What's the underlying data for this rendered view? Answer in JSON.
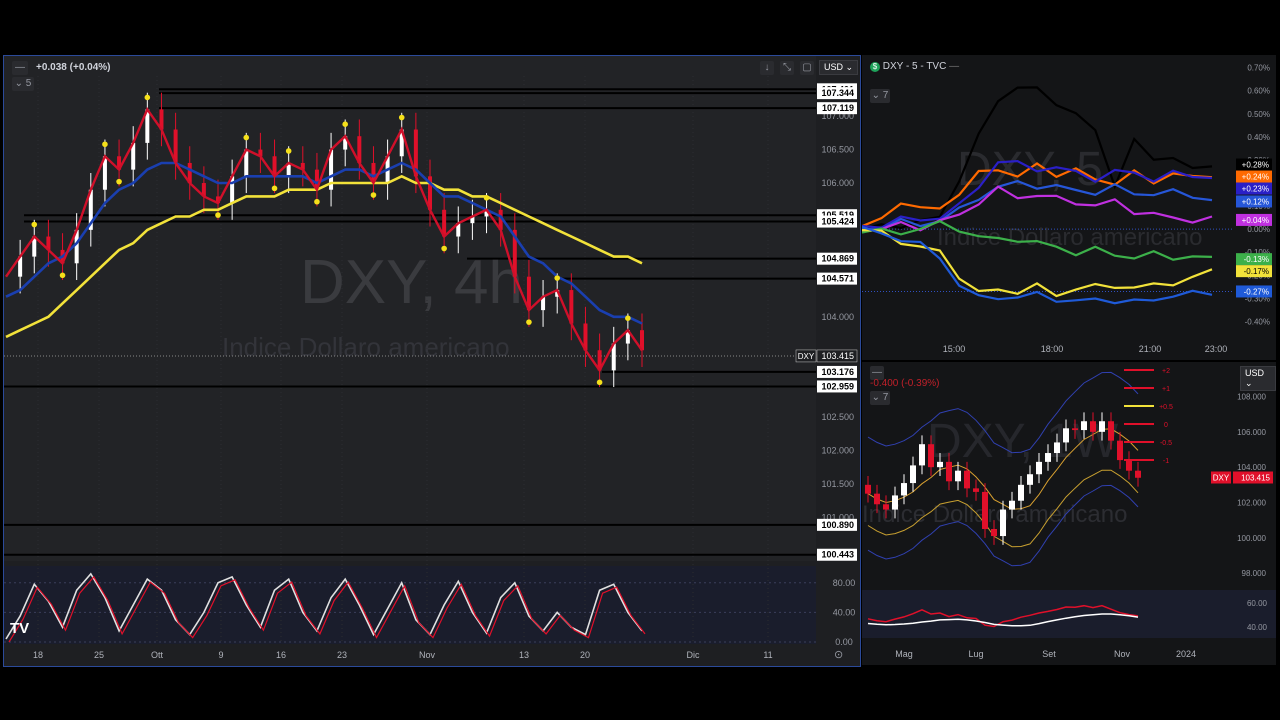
{
  "main": {
    "change_text": "+0.038 (+0.04%)",
    "collapse_glyph": "—",
    "indicator_count": "5",
    "currency": "USD",
    "watermark_title": "DXY, 4h",
    "watermark_subtitle": "Indice Dollaro americano",
    "symbol_tag": "DXY",
    "logo": "TV",
    "toolbar_icons": [
      "arrow-down-icon",
      "expand-icon",
      "maximize-icon"
    ],
    "settings_icon": "gear-icon",
    "colors": {
      "ema_fast": "#d0102a",
      "ema_mid": "#1a3fb0",
      "ema_slow": "#f2e23a",
      "pivot": "#f5e01a",
      "osc": "#e0e0e0",
      "osc_signal": "#e0102a"
    }
  },
  "chart_data": [
    {
      "type": "line",
      "title": "",
      "subtitle": "",
      "price_axis_ticks": [
        "107.000",
        "106.500",
        "106.000",
        "104.000",
        "102.500",
        "102.000",
        "101.500",
        "101.000"
      ],
      "price_labels": [
        "107.401",
        "107.344",
        "107.119",
        "105.519",
        "105.424",
        "104.869",
        "104.571",
        "103.415",
        "103.176",
        "102.959",
        "100.890",
        "100.443"
      ],
      "last_price": 103.415,
      "x_ticks": [
        "18",
        "25",
        "Ott",
        "9",
        "16",
        "23",
        "Nov",
        "13",
        "20",
        "Dic",
        "11"
      ],
      "ylim": [
        100.2,
        107.6
      ],
      "series": [
        {
          "values": [
            104.6,
            104.9,
            105.2,
            105.0,
            104.8,
            105.3,
            105.9,
            106.4,
            106.2,
            106.6,
            107.1,
            106.8,
            106.3,
            106.0,
            105.8,
            105.7,
            106.1,
            106.5,
            106.4,
            106.1,
            106.3,
            106.2,
            105.9,
            106.5,
            106.7,
            106.3,
            106.0,
            106.4,
            106.8,
            106.1,
            105.6,
            105.2,
            105.4,
            105.5,
            105.6,
            105.3,
            104.6,
            104.1,
            104.3,
            104.4,
            103.9,
            103.5,
            103.2,
            103.6,
            103.8,
            103.5
          ]
        },
        {
          "values": [
            104.3,
            104.4,
            104.6,
            104.8,
            104.9,
            105.1,
            105.4,
            105.7,
            105.9,
            106.0,
            106.2,
            106.3,
            106.3,
            106.2,
            106.1,
            106.0,
            106.0,
            106.1,
            106.1,
            106.1,
            106.1,
            106.1,
            106.0,
            106.1,
            106.2,
            106.2,
            106.1,
            106.2,
            106.3,
            106.2,
            106.0,
            105.8,
            105.8,
            105.7,
            105.6,
            105.5,
            105.2,
            104.9,
            104.8,
            104.6,
            104.5,
            104.3,
            104.1,
            104.0,
            104.0,
            103.9
          ]
        },
        {
          "values": [
            103.7,
            103.8,
            103.9,
            104.0,
            104.2,
            104.4,
            104.6,
            104.8,
            105.0,
            105.1,
            105.3,
            105.4,
            105.5,
            105.5,
            105.6,
            105.6,
            105.7,
            105.8,
            105.8,
            105.8,
            105.9,
            105.9,
            105.9,
            106.0,
            106.0,
            106.0,
            106.0,
            106.0,
            106.1,
            106.0,
            106.0,
            105.9,
            105.9,
            105.8,
            105.8,
            105.7,
            105.6,
            105.5,
            105.4,
            105.3,
            105.2,
            105.1,
            105.0,
            104.9,
            104.9,
            104.8
          ]
        },
        {
          "values": [
            4,
            35,
            78,
            55,
            20,
            70,
            92,
            60,
            15,
            50,
            85,
            70,
            30,
            10,
            40,
            80,
            88,
            50,
            20,
            70,
            85,
            40,
            15,
            60,
            85,
            50,
            10,
            45,
            80,
            30,
            10,
            50,
            82,
            40,
            12,
            60,
            80,
            35,
            15,
            40,
            20,
            10,
            70,
            78,
            40,
            15
          ]
        }
      ]
    },
    {
      "type": "line",
      "title": "DXY - 5 - TVC",
      "indicator_count": "7",
      "x_ticks": [
        "15:00",
        "18:00",
        "21:00",
        "23:00"
      ],
      "y_ticks": [
        "0.70%",
        "0.60%",
        "0.50%",
        "0.40%",
        "0.30%",
        "0.20%",
        "0.10%",
        "0.00%",
        "-0.10%",
        "-0.20%",
        "-0.30%",
        "-0.40%"
      ],
      "ylim": [
        -0.45,
        0.72
      ],
      "watermark_title": "DXY, 5",
      "watermark_subtitle": "Indice Dollaro americano",
      "series": [
        {
          "color": "#000000",
          "last_label": "+0.28%",
          "values": [
            0.0,
            0.01,
            0.02,
            0.03,
            0.05,
            0.22,
            0.4,
            0.56,
            0.62,
            0.6,
            0.55,
            0.5,
            0.42,
            0.2,
            0.38,
            0.3,
            0.32,
            0.25,
            0.28
          ]
        },
        {
          "color": "#ff6a00",
          "last_label": "+0.24%",
          "values": [
            0.0,
            0.05,
            0.12,
            0.08,
            0.1,
            0.15,
            0.24,
            0.27,
            0.22,
            0.28,
            0.24,
            0.25,
            0.22,
            0.2,
            0.24,
            0.21,
            0.24,
            0.22,
            0.24
          ]
        },
        {
          "color": "#2a1fc7",
          "last_label": "+0.23%",
          "values": [
            0.0,
            0.02,
            0.05,
            0.03,
            0.06,
            0.1,
            0.18,
            0.3,
            0.28,
            0.26,
            0.27,
            0.24,
            0.22,
            0.25,
            0.24,
            0.22,
            0.24,
            0.23,
            0.23
          ]
        },
        {
          "color": "#2656d8",
          "last_label": "+0.12%",
          "values": [
            0.0,
            0.01,
            0.03,
            0.02,
            0.04,
            0.08,
            0.14,
            0.18,
            0.2,
            0.19,
            0.18,
            0.17,
            0.16,
            0.18,
            0.16,
            0.15,
            0.16,
            0.15,
            0.12
          ]
        },
        {
          "color": "#c030e0",
          "last_label": "+0.04%",
          "values": [
            0.0,
            0.0,
            0.02,
            0.01,
            0.03,
            0.06,
            0.12,
            0.17,
            0.14,
            0.15,
            0.13,
            0.12,
            0.1,
            0.12,
            0.08,
            0.06,
            0.05,
            0.04,
            0.04
          ]
        },
        {
          "color": "#3cb04a",
          "last_label": "-0.13%",
          "values": [
            0.0,
            -0.01,
            -0.02,
            0.01,
            0.02,
            0.0,
            -0.03,
            -0.05,
            -0.04,
            -0.06,
            -0.08,
            -0.1,
            -0.09,
            -0.11,
            -0.12,
            -0.11,
            -0.12,
            -0.12,
            -0.13
          ]
        },
        {
          "color": "#f2e23a",
          "last_label": "-0.17%",
          "values": [
            0.0,
            -0.02,
            -0.05,
            -0.08,
            -0.1,
            -0.2,
            -0.28,
            -0.26,
            -0.27,
            -0.25,
            -0.28,
            -0.26,
            -0.25,
            -0.24,
            -0.26,
            -0.24,
            -0.23,
            -0.22,
            -0.17
          ]
        },
        {
          "color": "#1f5ad8",
          "last_label": "-0.27%",
          "values": [
            0.0,
            -0.02,
            -0.04,
            -0.07,
            -0.12,
            -0.24,
            -0.3,
            -0.29,
            -0.3,
            -0.28,
            -0.3,
            -0.32,
            -0.3,
            -0.31,
            -0.32,
            -0.3,
            -0.29,
            -0.28,
            -0.27
          ]
        }
      ]
    },
    {
      "type": "bar",
      "title": "",
      "change_text": "-0.400 (-0.39%)",
      "indicator_count": "7",
      "currency": "USD",
      "symbol_tag": "DXY",
      "last_price": 103.415,
      "last_price_label": "103.415",
      "x_ticks": [
        "Mag",
        "Lug",
        "Set",
        "Nov",
        "2024"
      ],
      "y_ticks": [
        "108.000",
        "106.000",
        "104.000",
        "102.000",
        "100.000",
        "98.000"
      ],
      "osc_ticks": [
        "60.00",
        "40.00"
      ],
      "level_tags": [
        "+2",
        "+1",
        "+0.5",
        "0",
        "-0.5",
        "-1"
      ],
      "ylim": [
        97.5,
        109.5
      ],
      "watermark_title": "DXY, 1W",
      "watermark_subtitle": "Indice Dollaro americano",
      "weekly_close": [
        102.5,
        101.9,
        101.6,
        102.4,
        103.1,
        104.1,
        105.3,
        104.0,
        104.3,
        103.2,
        103.8,
        102.8,
        102.6,
        100.5,
        100.1,
        101.6,
        102.1,
        103.0,
        103.6,
        104.3,
        104.8,
        105.4,
        106.2,
        106.1,
        106.6,
        106.0,
        106.6,
        105.5,
        104.4,
        103.8,
        103.4
      ]
    }
  ]
}
